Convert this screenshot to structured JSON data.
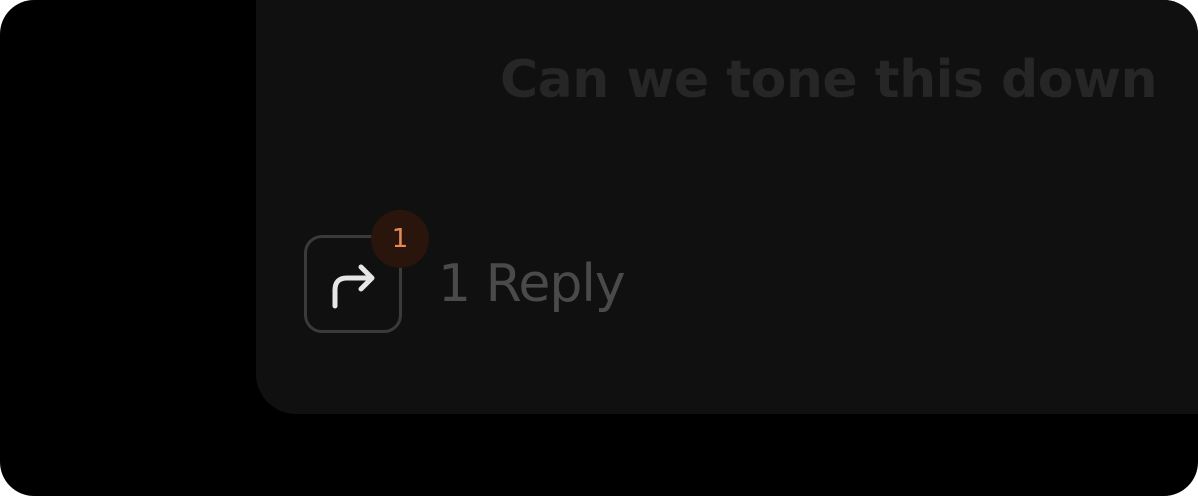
{
  "comment": {
    "text": "Can we tone this down"
  },
  "replies": {
    "badge_count": "1",
    "label": "1 Reply",
    "icon": "reply-arrow-icon"
  },
  "colors": {
    "background": "#000000",
    "card": "#101010",
    "badge_bg": "#2a150c",
    "badge_text": "#e58a55",
    "label_text": "#4a4a4a"
  }
}
